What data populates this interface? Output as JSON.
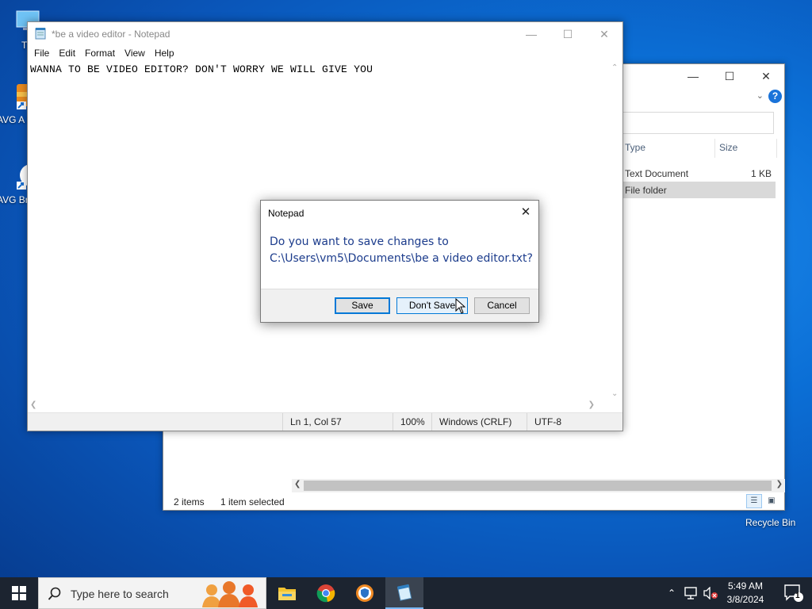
{
  "desktop": {
    "icons": [
      {
        "label": "Th",
        "name": "this-pc"
      },
      {
        "label": "AVG A F",
        "name": "avg-antivirus"
      },
      {
        "label": "AVG Bro",
        "name": "avg-browser"
      }
    ],
    "recycle_bin_label": "Recycle Bin"
  },
  "explorer": {
    "columns": {
      "type": "Type",
      "size": "Size"
    },
    "rows": [
      {
        "type": "Text Document",
        "size": "1 KB",
        "selected": false
      },
      {
        "type": "File folder",
        "size": "",
        "selected": true
      }
    ],
    "status": {
      "items": "2 items",
      "selected": "1 item selected"
    }
  },
  "notepad": {
    "title": "*be a video editor - Notepad",
    "menu": [
      "File",
      "Edit",
      "Format",
      "View",
      "Help"
    ],
    "content": "WANNA TO BE VIDEO EDITOR? DON'T WORRY WE WILL GIVE YOU",
    "status": {
      "position": "Ln 1, Col 57",
      "zoom": "100%",
      "line_ending": "Windows (CRLF)",
      "encoding": "UTF-8"
    }
  },
  "dialog": {
    "title": "Notepad",
    "message_line1": "Do you want to save changes to",
    "message_line2": "C:\\Users\\vm5\\Documents\\be a video editor.txt?",
    "buttons": {
      "save": "Save",
      "dont_save": "Don't Save",
      "cancel": "Cancel"
    }
  },
  "taskbar": {
    "search_placeholder": "Type here to search",
    "apps": [
      "file-explorer",
      "chrome",
      "avg-secure-browser",
      "notepad"
    ],
    "clock": {
      "time": "5:49 AM",
      "date": "3/8/2024"
    },
    "notification_count": "1"
  },
  "colors": {
    "accent": "#0078d7",
    "dialog_text": "#1c3c8c",
    "taskbar": "#1c2430",
    "selection": "#d9d9d9"
  }
}
